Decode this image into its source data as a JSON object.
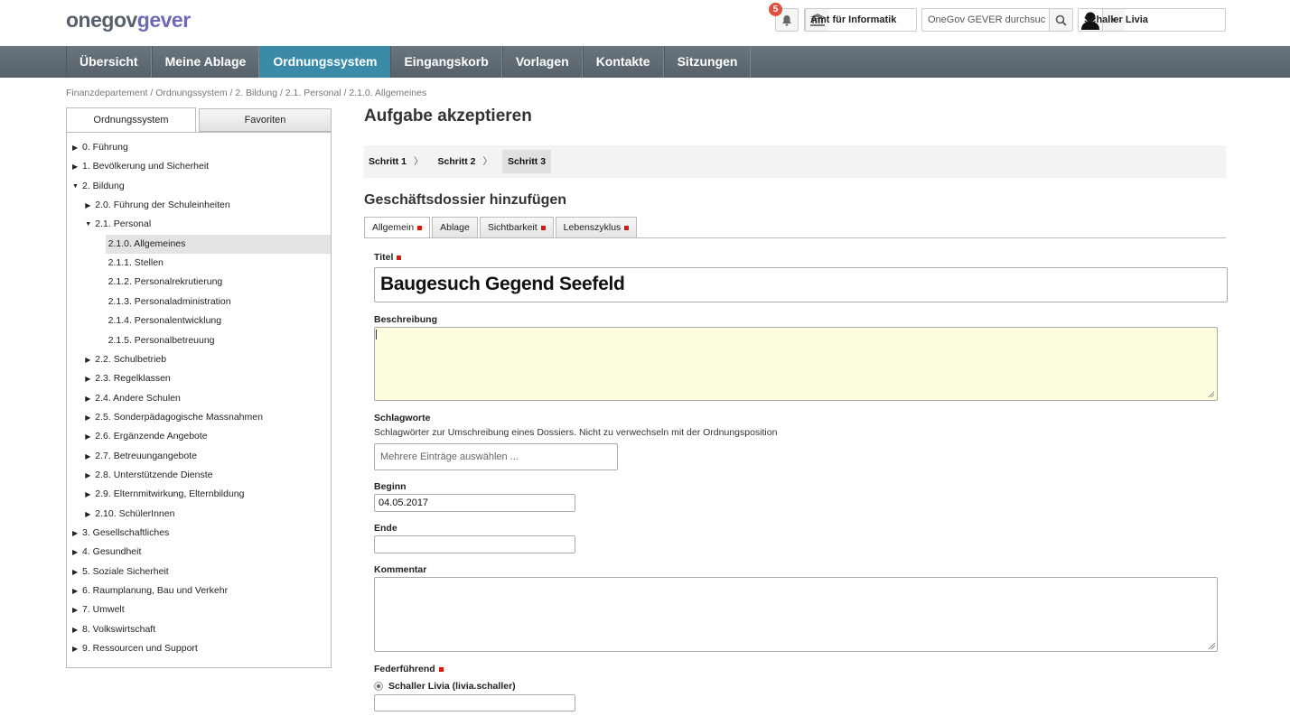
{
  "header": {
    "logo": {
      "part1": "one",
      "part2": "gov",
      "part3": "gever"
    },
    "notifications": {
      "count": "5",
      "icon": "bell-icon"
    },
    "org_unit": {
      "label": "Amt für Informatik",
      "icon": "institution-icon"
    },
    "search": {
      "placeholder": "OneGov GEVER durchsuc",
      "icon": "search-icon"
    },
    "user": {
      "name": "Schaller Livia",
      "icon": "user-avatar-icon"
    }
  },
  "nav": {
    "items": [
      {
        "label": "Übersicht"
      },
      {
        "label": "Meine Ablage"
      },
      {
        "label": "Ordnungssystem",
        "active": true
      },
      {
        "label": "Eingangskorb"
      },
      {
        "label": "Vorlagen"
      },
      {
        "label": "Kontakte"
      },
      {
        "label": "Sitzungen"
      }
    ]
  },
  "breadcrumb": "Finanzdepartement / Ordnungssystem / 2. Bildung / 2.1. Personal / 2.1.0. Allgemeines",
  "sidebar": {
    "tabs": [
      {
        "label": "Ordnungssystem"
      },
      {
        "label": "Favoriten"
      }
    ],
    "tree": [
      {
        "label": "0. Führung",
        "arrow": "right"
      },
      {
        "label": "1. Bevölkerung und Sicherheit",
        "arrow": "right"
      },
      {
        "label": "2. Bildung",
        "arrow": "down"
      },
      {
        "label": "2.0. Führung der Schuleinheiten",
        "arrow": "right"
      },
      {
        "label": "2.1. Personal",
        "arrow": "down"
      },
      {
        "label": "2.1.0. Allgemeines",
        "selected": true
      },
      {
        "label": "2.1.1. Stellen"
      },
      {
        "label": "2.1.2. Personalrekrutierung"
      },
      {
        "label": "2.1.3. Personaladministration"
      },
      {
        "label": "2.1.4. Personalentwicklung"
      },
      {
        "label": "2.1.5. Personalbetreuung"
      },
      {
        "label": "2.2. Schulbetrieb",
        "arrow": "right"
      },
      {
        "label": "2.3. Regelklassen",
        "arrow": "right"
      },
      {
        "label": "2.4. Andere Schulen",
        "arrow": "right"
      },
      {
        "label": "2.5. Sonderpädagogische Massnahmen",
        "arrow": "right"
      },
      {
        "label": "2.6. Ergänzende Angebote",
        "arrow": "right"
      },
      {
        "label": "2.7. Betreuungangebote",
        "arrow": "right"
      },
      {
        "label": "2.8. Unterstützende Dienste",
        "arrow": "right"
      },
      {
        "label": "2.9. Elternmitwirkung, Elternbildung",
        "arrow": "right"
      },
      {
        "label": "2.10. SchülerInnen",
        "arrow": "right"
      },
      {
        "label": "3. Gesellschaftliches",
        "arrow": "right"
      },
      {
        "label": "4. Gesundheit",
        "arrow": "right"
      },
      {
        "label": "5. Soziale Sicherheit",
        "arrow": "right"
      },
      {
        "label": "6. Raumplanung, Bau und Verkehr",
        "arrow": "right"
      },
      {
        "label": "7. Umwelt",
        "arrow": "right"
      },
      {
        "label": "8. Volkswirtschaft",
        "arrow": "right"
      },
      {
        "label": "9. Ressourcen und Support",
        "arrow": "right"
      }
    ]
  },
  "main": {
    "title": "Aufgabe akzeptieren",
    "steps": [
      {
        "label": "Schritt 1"
      },
      {
        "label": "Schritt 2"
      },
      {
        "label": "Schritt 3",
        "current": true
      }
    ],
    "section_title": "Geschäftsdossier hinzufügen",
    "form_tabs": [
      {
        "label": "Allgemein",
        "required": true,
        "active": true
      },
      {
        "label": "Ablage",
        "required": false
      },
      {
        "label": "Sichtbarkeit",
        "required": true
      },
      {
        "label": "Lebenszyklus",
        "required": true
      }
    ],
    "fields": {
      "titel": {
        "label": "Titel",
        "value": "Baugesuch Gegend Seefeld"
      },
      "beschreibung": {
        "label": "Beschreibung",
        "value": ""
      },
      "schlagworte": {
        "label": "Schlagworte",
        "help": "Schlagwörter zur Umschreibung eines Dossiers. Nicht zu verwechseln mit der Ordnungsposition",
        "placeholder": "Mehrere Einträge auswählen ..."
      },
      "beginn": {
        "label": "Beginn",
        "value": "04.05.2017"
      },
      "ende": {
        "label": "Ende",
        "value": ""
      },
      "kommentar": {
        "label": "Kommentar",
        "value": ""
      },
      "federfuehrend": {
        "label": "Federführend",
        "option": "Schaller Livia (livia.schaller)",
        "value": ""
      }
    }
  },
  "colors": {
    "nav_bg": "#5f6a73",
    "nav_active": "#3a8aa8",
    "required_marker": "#d9190d",
    "textarea_focus_bg": "#fffde0",
    "badge": "#e0503c",
    "logo_accent": "#6f6ab7"
  }
}
